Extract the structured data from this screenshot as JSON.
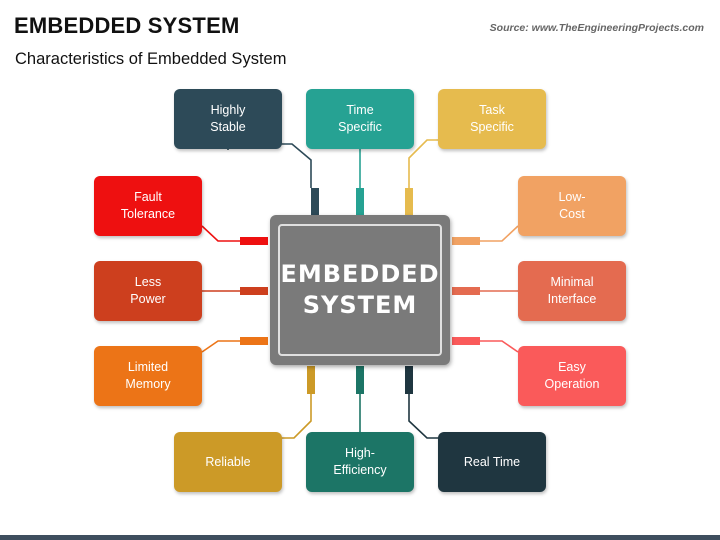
{
  "header": {
    "title": "EMBEDDED SYSTEM",
    "subtitle": "Characteristics of Embedded System",
    "source": "Source: www.TheEngineeringProjects.com"
  },
  "center": {
    "label": "EMBEDDED\nSYSTEM",
    "color": "#7a7a7a"
  },
  "characteristics": [
    {
      "id": "highly-stable",
      "label": "Highly\nStable",
      "color": "#2d4a58",
      "side": "top"
    },
    {
      "id": "time-specific",
      "label": "Time\nSpecific",
      "color": "#26a293",
      "side": "top"
    },
    {
      "id": "task-specific",
      "label": "Task\nSpecific",
      "color": "#e6bb4e",
      "side": "top"
    },
    {
      "id": "fault-tolerance",
      "label": "Fault\nTolerance",
      "color": "#ee1010",
      "side": "left"
    },
    {
      "id": "less-power",
      "label": "Less\nPower",
      "color": "#cd3f1e",
      "side": "left"
    },
    {
      "id": "limited-memory",
      "label": "Limited\nMemory",
      "color": "#ec7417",
      "side": "left"
    },
    {
      "id": "low-cost",
      "label": "Low-\nCost",
      "color": "#f1a263",
      "side": "right"
    },
    {
      "id": "minimal-interface",
      "label": "Minimal\nInterface",
      "color": "#e46b50",
      "side": "right"
    },
    {
      "id": "easy-operation",
      "label": "Easy\nOperation",
      "color": "#fa5a5a",
      "side": "right"
    },
    {
      "id": "reliable",
      "label": "Reliable",
      "color": "#cc9a27",
      "side": "bottom"
    },
    {
      "id": "high-efficiency",
      "label": "High-\nEfficiency",
      "color": "#1c7566",
      "side": "bottom"
    },
    {
      "id": "real-time",
      "label": "Real Time",
      "color": "#1f3640",
      "side": "bottom"
    }
  ]
}
